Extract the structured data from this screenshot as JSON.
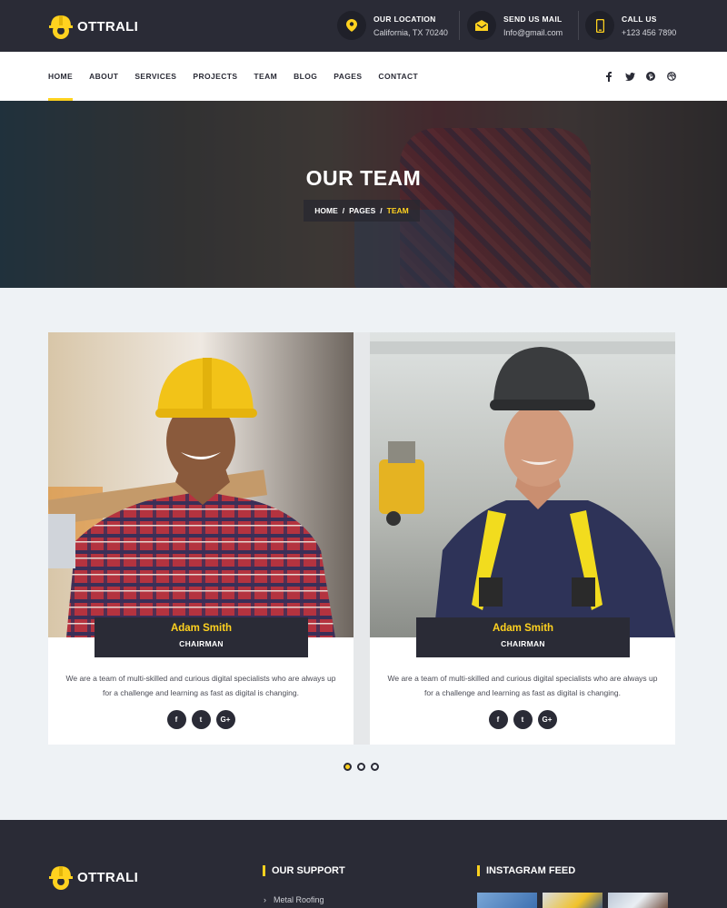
{
  "brand": {
    "name": "OTTRALI",
    "accent": "#ffd21f",
    "dark": "#2a2b36"
  },
  "topbar": {
    "location": {
      "label": "OUR LOCATION",
      "value": "California, TX 70240",
      "icon": "map-pin-icon"
    },
    "mail": {
      "label": "SEND US MAIL",
      "value": "Info@gmail.com",
      "icon": "envelope-icon"
    },
    "call": {
      "label": "CALL US",
      "value": "+123 456 7890",
      "icon": "phone-icon"
    }
  },
  "nav": {
    "items": [
      "HOME",
      "ABOUT",
      "SERVICES",
      "PROJECTS",
      "TEAM",
      "BLOG",
      "PAGES",
      "CONTACT"
    ],
    "active": "HOME",
    "social": [
      "facebook-icon",
      "twitter-icon",
      "pinterest-icon",
      "dribbble-icon"
    ]
  },
  "hero": {
    "title": "OUR TEAM",
    "breadcrumb": [
      "HOME",
      "PAGES",
      "TEAM"
    ],
    "separator": "/"
  },
  "team": [
    {
      "name": "Adam Smith",
      "role": "CHAIRMAN",
      "desc": "We are a team of multi-skilled and curious digital specialists who are always up for a challenge and learning as fast as digital is changing."
    },
    {
      "name": "Adam Smith",
      "role": "CHAIRMAN",
      "desc": "We are a team of multi-skilled and curious digital specialists who are always up for a challenge and learning as fast as digital is changing."
    }
  ],
  "card_social": {
    "fb": "f",
    "tw": "t",
    "gp": "G+"
  },
  "carousel": {
    "total": 3,
    "active": 1
  },
  "footer": {
    "brand": "OTTRALI",
    "support_title": "OUR SUPPORT",
    "support_link": "Metal Roofing",
    "insta_title": "INSTAGRAM FEED"
  }
}
